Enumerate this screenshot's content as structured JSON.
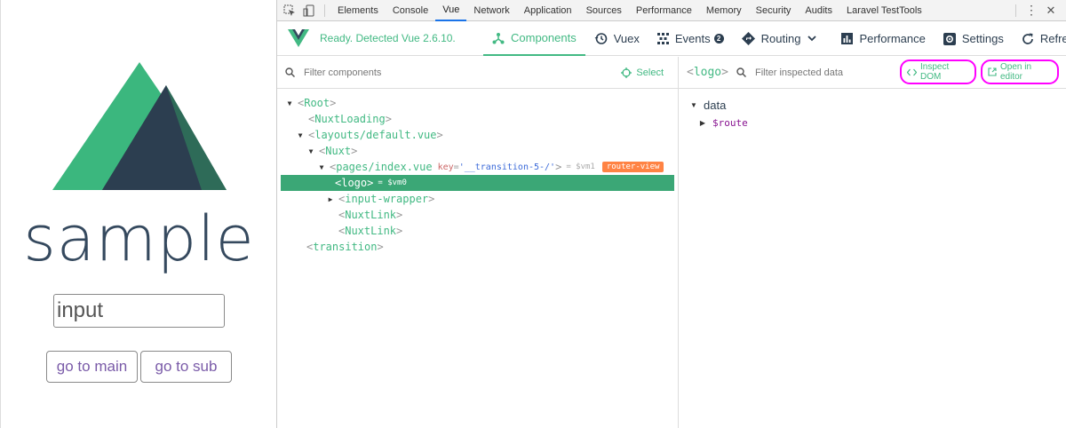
{
  "app": {
    "title": "sample",
    "input": {
      "value": "input",
      "placeholder": ""
    },
    "buttons": {
      "main": "go to main",
      "sub": "go to sub"
    },
    "colors": {
      "logo_green": "#3bb77e",
      "logo_dark_green": "#2e6b58",
      "logo_navy": "#2c3e50",
      "link_purple": "#7a5ba8"
    }
  },
  "devtools": {
    "tabs": [
      "Elements",
      "Console",
      "Vue",
      "Network",
      "Application",
      "Sources",
      "Performance",
      "Memory",
      "Security",
      "Audits",
      "Laravel TestTools"
    ],
    "active_tab": "Vue",
    "icons": {
      "inspect": "inspect-element-icon",
      "device": "device-toolbar-icon",
      "menu": "more-vert-icon",
      "close": "close-icon"
    },
    "close_glyph": "✕",
    "menu_glyph": "⋮"
  },
  "vue": {
    "status": "Ready. Detected Vue 2.6.10.",
    "accent": "#42b983",
    "nav": [
      {
        "label": "Components",
        "icon": "components-icon"
      },
      {
        "label": "Vuex",
        "icon": "history-icon"
      },
      {
        "label": "Events",
        "icon": "events-icon",
        "badge": "2"
      },
      {
        "label": "Routing",
        "icon": "routing-icon"
      },
      {
        "label": "Performance",
        "icon": "chart-icon"
      },
      {
        "label": "Settings",
        "icon": "settings-icon"
      },
      {
        "label": "Refresh",
        "icon": "refresh-icon"
      }
    ],
    "tree": {
      "filter_placeholder": "Filter components",
      "select_label": "Select",
      "nodes": {
        "root": "Root",
        "nuxt_loading": "NuxtLoading",
        "layout": "layouts/default.vue",
        "nuxt": "Nuxt",
        "pages_index": "pages/index.vue",
        "pages_key_name": "key",
        "pages_key_value": "'__transition-5-/'",
        "pages_vm": "= $vm1",
        "router_view_tag": "router-view",
        "logo": "logo",
        "logo_vm": "= $vm0",
        "input_wrapper": "input-wrapper",
        "nuxt_link_1": "NuxtLink",
        "nuxt_link_2": "NuxtLink",
        "transition": "transition"
      }
    },
    "inspector": {
      "component": "logo",
      "filter_placeholder": "Filter inspected data",
      "inspect_dom_label": "Inspect DOM",
      "open_editor_label": "Open in editor",
      "section": "data",
      "route_key": "$route"
    }
  }
}
